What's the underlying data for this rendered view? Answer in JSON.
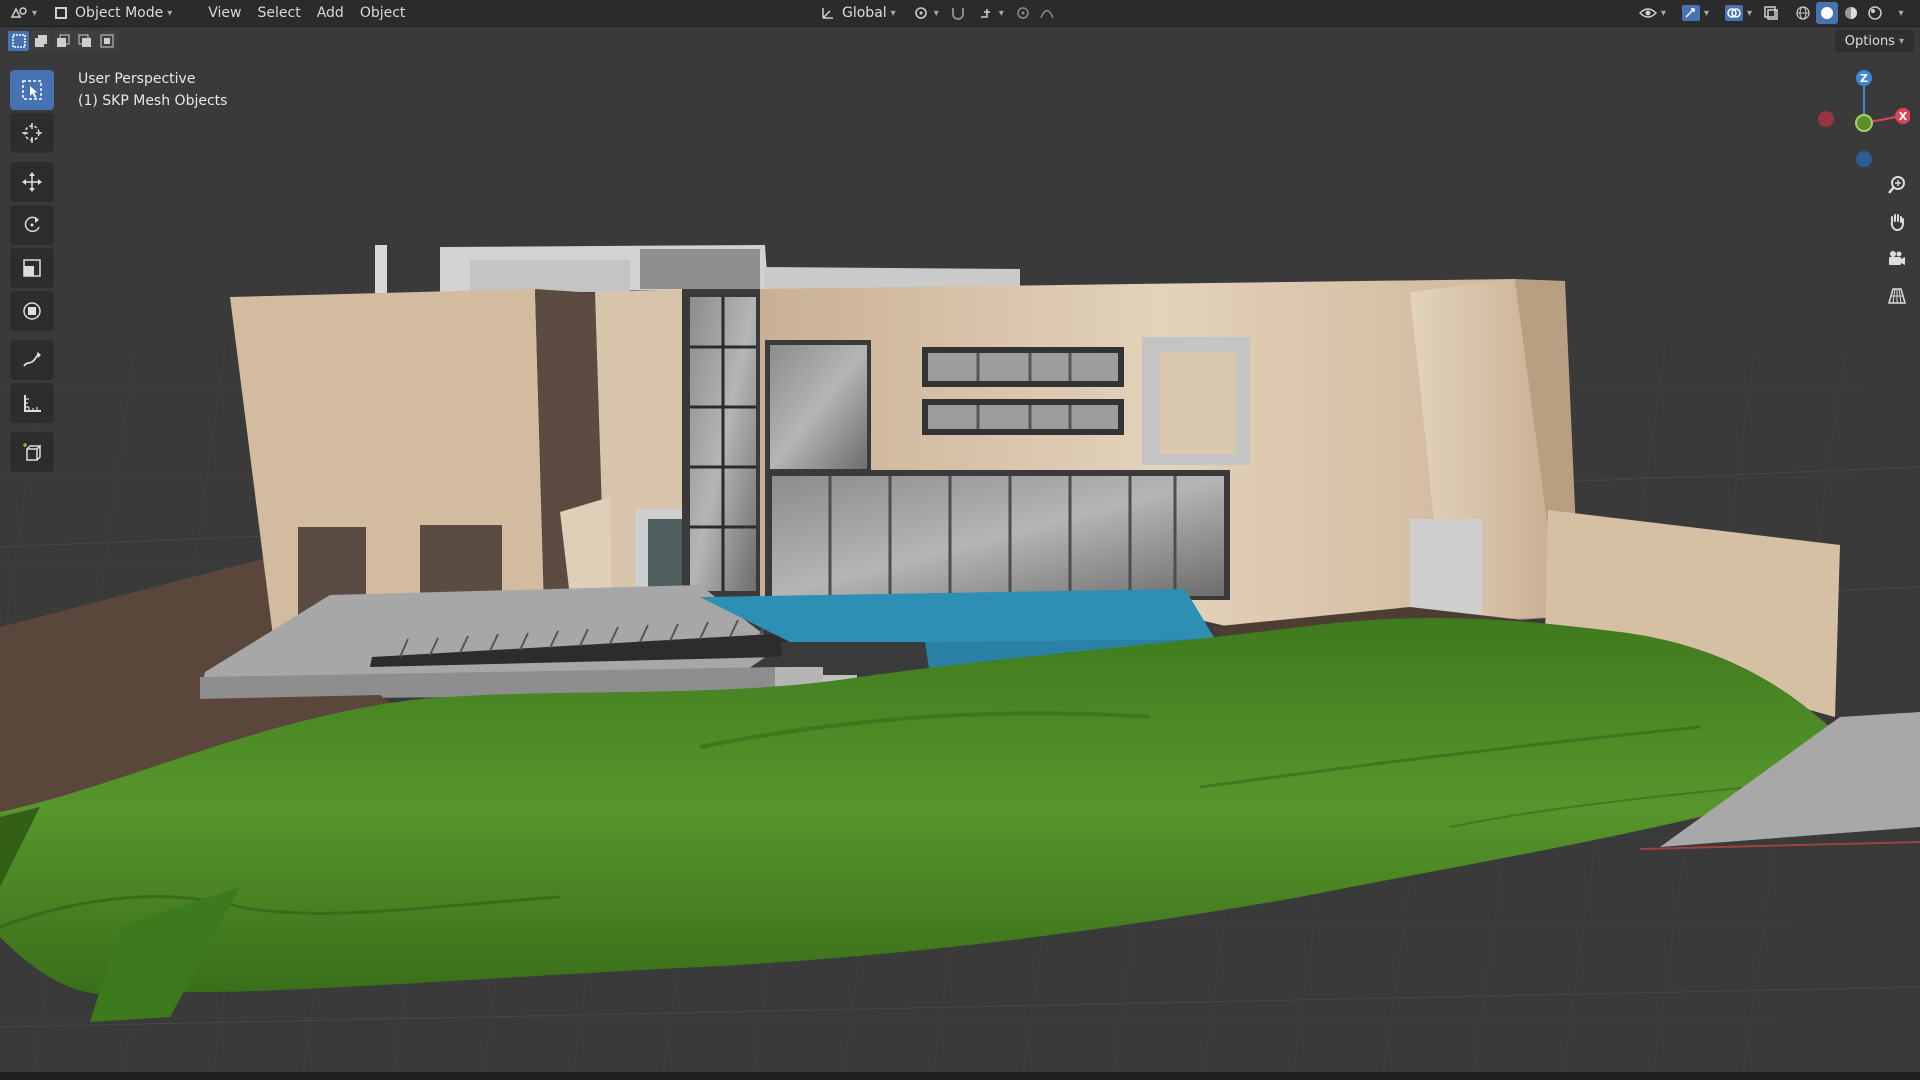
{
  "header": {
    "mode_label": "Object Mode",
    "menus": [
      "View",
      "Select",
      "Add",
      "Object"
    ],
    "transform_orientation": "Global"
  },
  "viewport": {
    "view_name": "User Perspective",
    "collection_info": "(1) SKP Mesh Objects",
    "options_label": "Options"
  },
  "gizmo": {
    "z_label": "Z",
    "x_label": "X",
    "colors": {
      "x": "#e04455",
      "y": "#7fc13a",
      "z": "#3f85d8"
    }
  },
  "tools": [
    "select-box",
    "cursor",
    "move",
    "rotate",
    "scale",
    "transform",
    "annotate",
    "measure",
    "add-cube"
  ],
  "colors": {
    "accent": "#4772b3",
    "grass": "#4b8a25",
    "wall": "#d6c0a4",
    "water": "#2d8fb5"
  }
}
